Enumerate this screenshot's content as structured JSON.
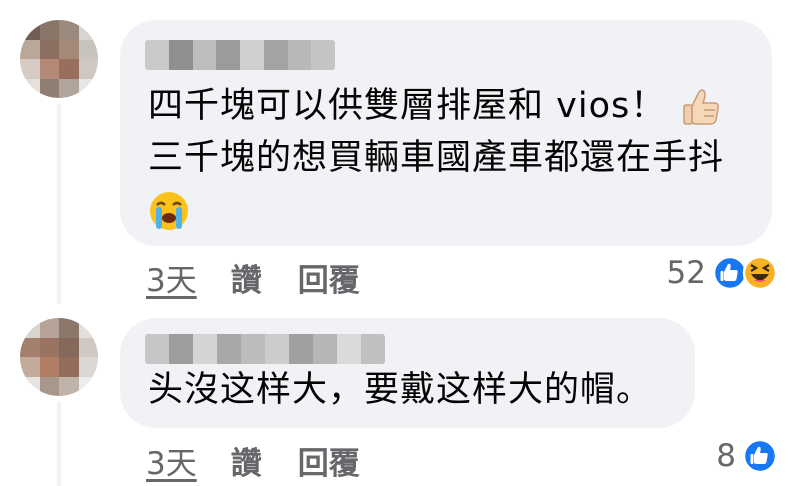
{
  "comments": [
    {
      "author": "",
      "lines": [
        "四千塊可以供雙層排屋和 vios！",
        "三千塊的想買輛車國產車都還在手抖"
      ],
      "thumbs_up_emoji": "thumbs-up-icon",
      "crying_emoji": "loudly-crying-face-icon",
      "time": "3天",
      "like_label": "讚",
      "reply_label": "回覆",
      "reaction_count": "52",
      "reactions": [
        "like-reaction-icon",
        "haha-reaction-icon"
      ]
    },
    {
      "author": "",
      "lines": [
        "头沒这样大，要戴这样大的帽。"
      ],
      "time": "3天",
      "like_label": "讚",
      "reply_label": "回覆",
      "reaction_count": "8",
      "reactions": [
        "like-reaction-icon"
      ]
    }
  ],
  "colors": {
    "bubble": "#f0f2f5",
    "secondary_text": "#65676b",
    "like_blue": "#1877f2",
    "haha_yellow": "#f7b125"
  }
}
